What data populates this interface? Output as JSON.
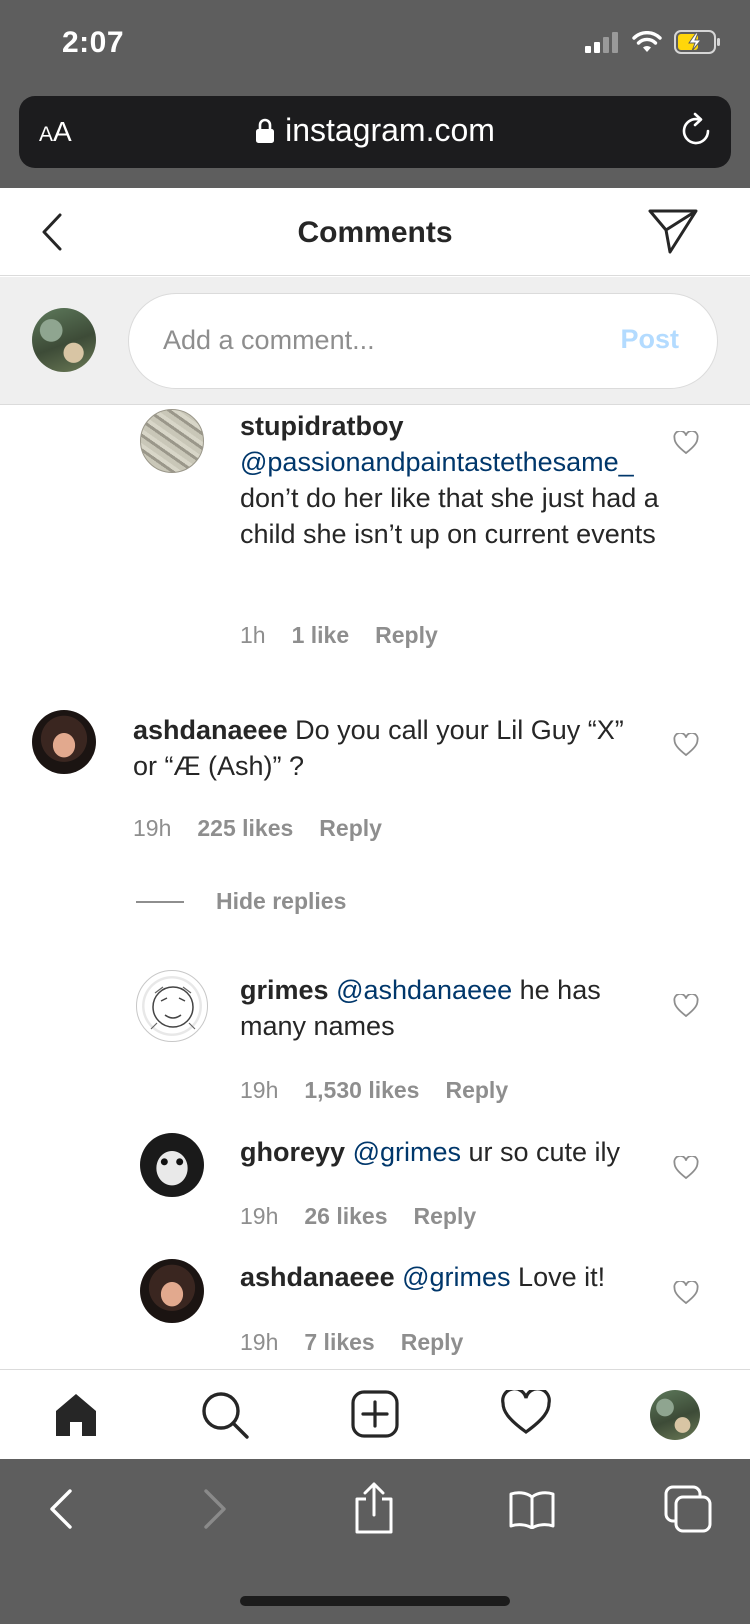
{
  "status": {
    "time": "2:07"
  },
  "browser": {
    "text_size_label": "AA",
    "domain": "instagram.com"
  },
  "header": {
    "title": "Comments"
  },
  "composer": {
    "placeholder": "Add a comment...",
    "post_label": "Post"
  },
  "comments": [
    {
      "username": "stupidratboy",
      "mention": "@passionandpaintastethesame_",
      "text": "don’t do her like that she just had a child she isn’t up on current events",
      "time": "1h",
      "likes": "1 like",
      "reply": "Reply"
    },
    {
      "username": "ashdanaeee",
      "text": "Do you call your Lil Guy “X” or “Æ (Ash)” ?",
      "time": "19h",
      "likes": "225 likes",
      "reply": "Reply"
    }
  ],
  "hide_replies": "Hide replies",
  "replies": [
    {
      "username": "grimes",
      "mention": "@ashdanaeee",
      "text": "he has many names",
      "time": "19h",
      "likes": "1,530 likes",
      "reply": "Reply"
    },
    {
      "username": "ghoreyy",
      "mention": "@grimes",
      "text": "ur so cute ily",
      "time": "19h",
      "likes": "26 likes",
      "reply": "Reply"
    },
    {
      "username": "ashdanaeee",
      "mention": "@grimes",
      "text": "Love it!",
      "time": "19h",
      "likes": "7 likes",
      "reply": "Reply"
    }
  ],
  "tabs": [
    "home-icon",
    "search-icon",
    "new-post-icon",
    "activity-heart-icon",
    "profile-avatar"
  ],
  "safari_toolbar": [
    "back-icon",
    "forward-icon",
    "share-icon",
    "bookmarks-icon",
    "tabs-icon"
  ],
  "colors": {
    "mention": "#00376b",
    "meta": "#8e8e8e",
    "post_disabled": "#b3dbff",
    "chrome": "#5e5e5e"
  }
}
